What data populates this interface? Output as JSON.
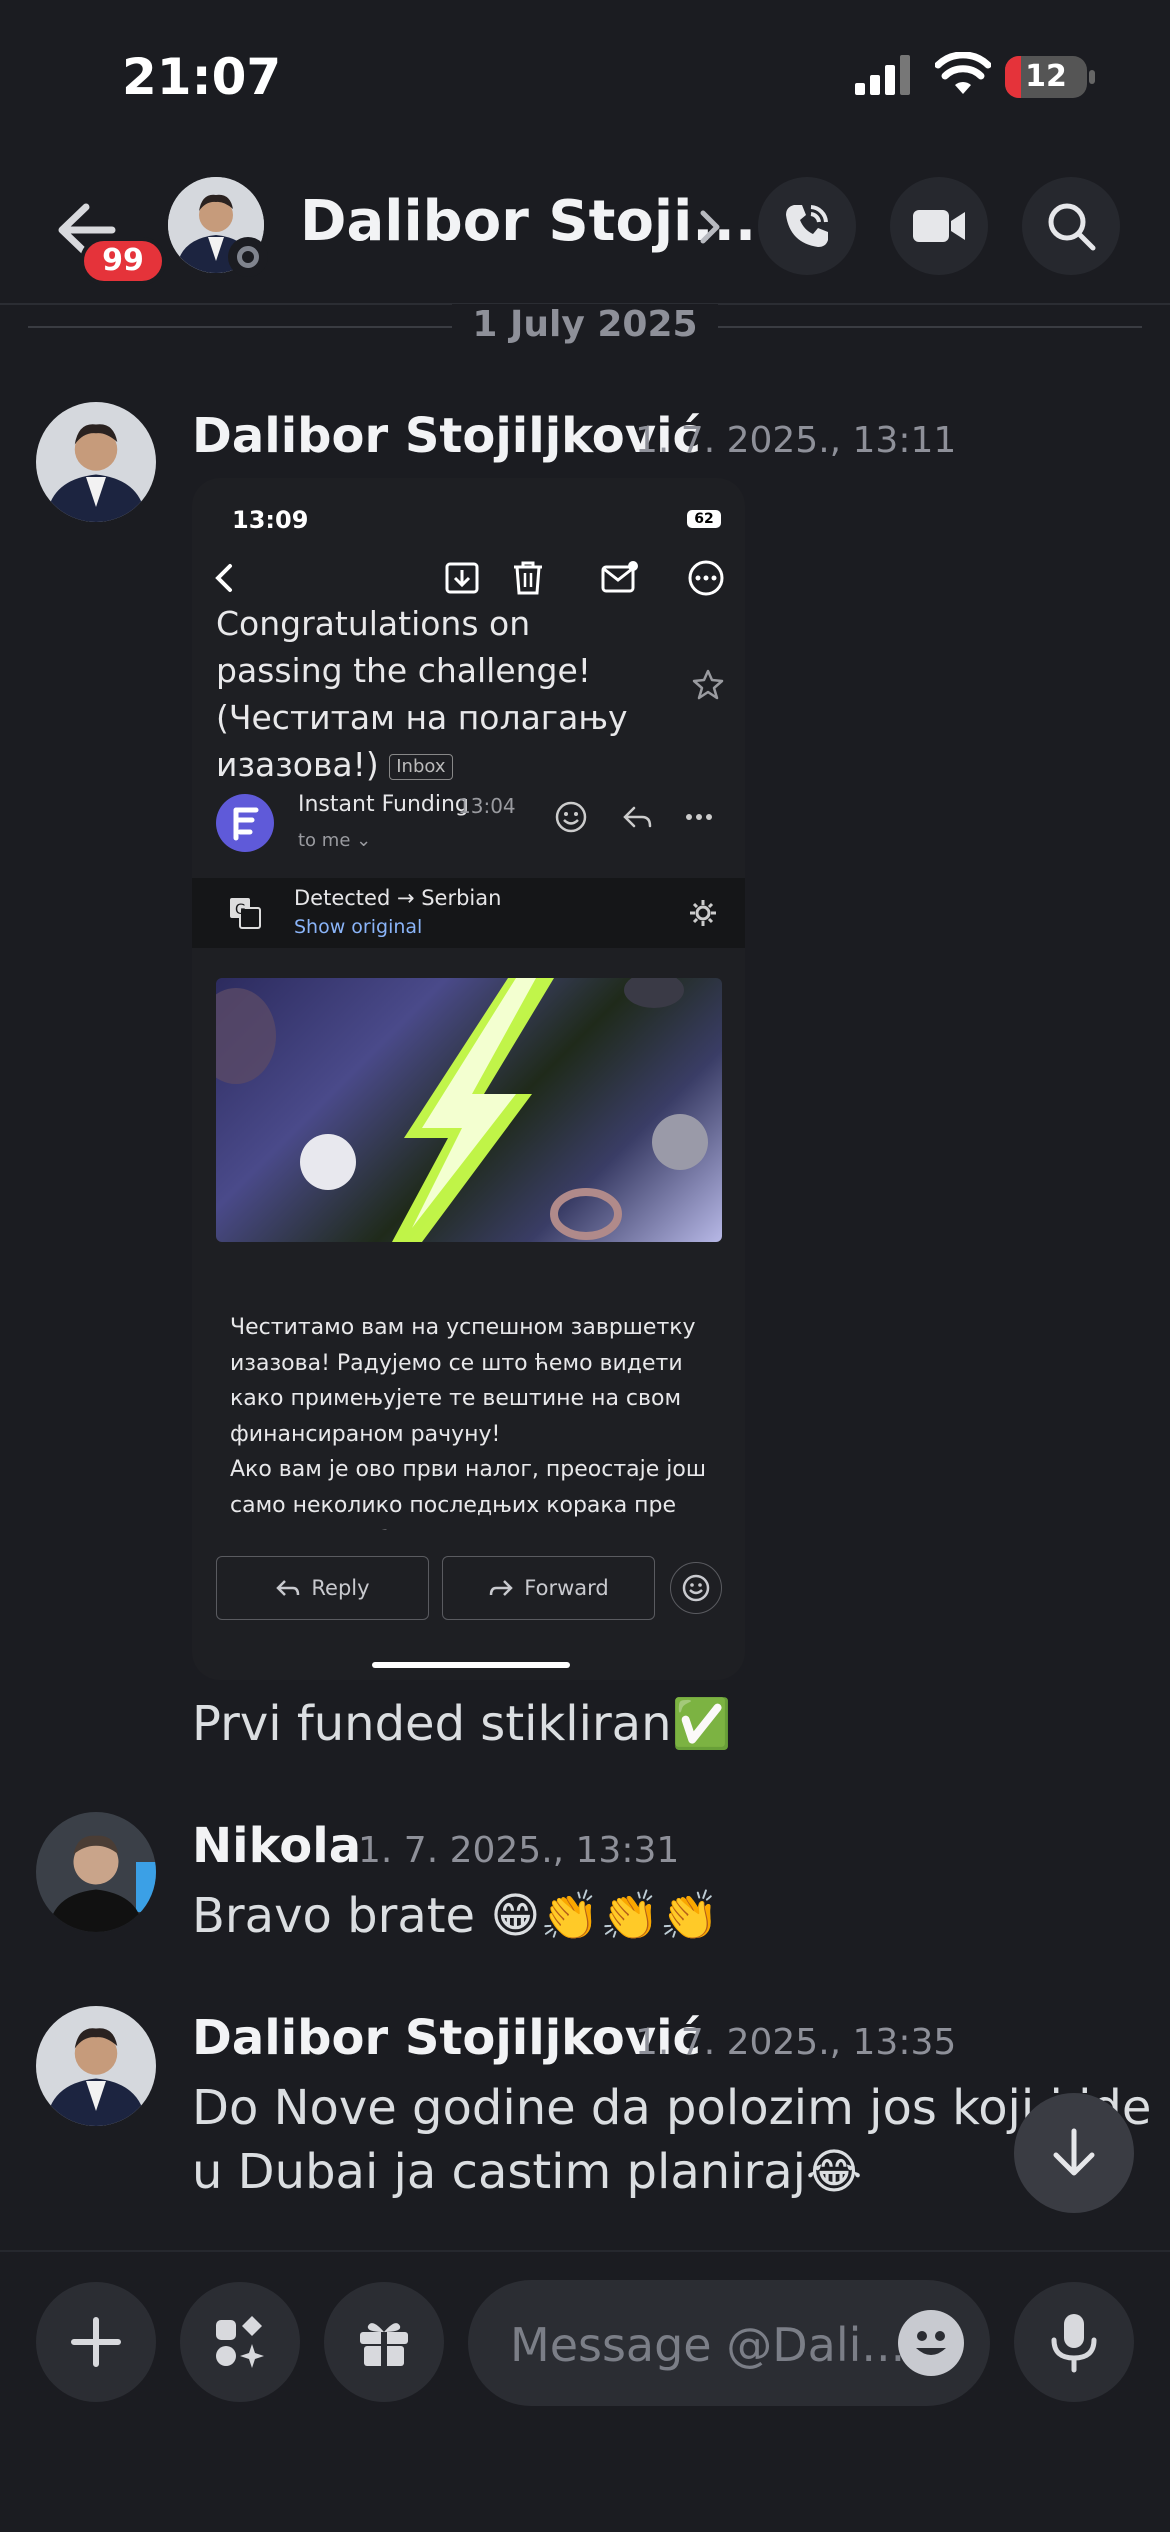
{
  "status_bar": {
    "time": "21:07",
    "battery": "12",
    "battery_level_percent": 12
  },
  "header": {
    "back_badge": "99",
    "title": "Dalibor Stoji...",
    "presence": "offline"
  },
  "date_divider": "1 July 2025",
  "messages": [
    {
      "author": "Dalibor Stojiljković",
      "timestamp": "1. 7. 2025., 13:11",
      "text": "Prvi funded stikliran✅"
    },
    {
      "author": "Nikola",
      "timestamp": "1. 7. 2025., 13:31",
      "text": "Bravo brate 😁👏👏👏"
    },
    {
      "author": "Dalibor Stojiljković",
      "timestamp": "1. 7. 2025., 13:35",
      "text_line1": "Do Nove godine da polozim jos koji i idem",
      "text_line2": "u Dubai ja castim planiraj😂"
    }
  ],
  "attachment": {
    "time": "13:09",
    "battery": "62",
    "subject": "Congratulations on passing the challenge! (Честитам на полагању изазова!)",
    "subject_tag": "Inbox",
    "sender": "Instant Funding",
    "sent_time": "13:04",
    "to": "to me ⌄",
    "translate_line1": "Detected → Serbian",
    "translate_line2": "Show original",
    "body": "Честитамо вам на успешном завршетку изазова! Радујемо се што ћемо видети како примењујете те вештине на свом финансираном рачуну!\nАко вам је ово први налог, преостаје још само неколико последњих корака пре него што га будемо могли активирати:",
    "reply_label": "Reply",
    "forward_label": "Forward"
  },
  "composer": {
    "placeholder": "Message @Dali..."
  },
  "colors": {
    "background": "#1b1c21",
    "badge": "#e5333a",
    "accent_link": "#8ab4f8",
    "bolt": "#c9ff4a"
  },
  "icons": [
    "back-arrow-icon",
    "phone-icon",
    "video-icon",
    "search-icon",
    "chevron-right-icon",
    "arrow-down-icon",
    "plus-icon",
    "apps-icon",
    "gift-icon",
    "emoji-icon",
    "microphone-icon"
  ]
}
